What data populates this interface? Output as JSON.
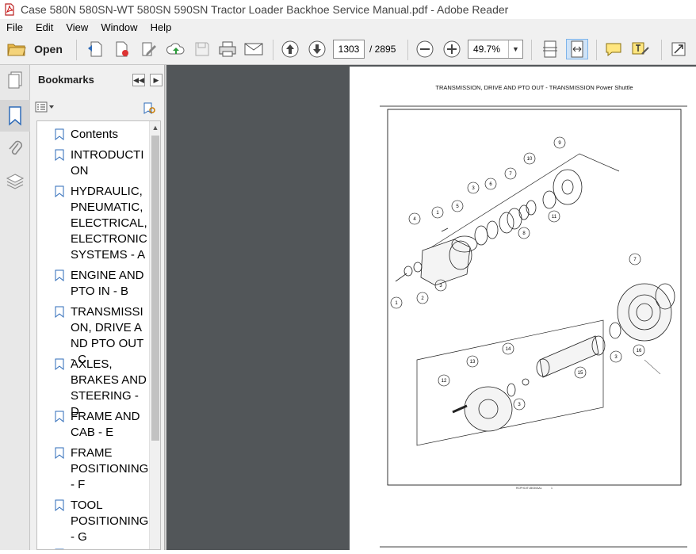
{
  "window": {
    "title": "Case 580N 580SN-WT 580SN 590SN Tractor Loader Backhoe Service Manual.pdf - Adobe Reader"
  },
  "menu": [
    "File",
    "Edit",
    "View",
    "Window",
    "Help"
  ],
  "toolbar": {
    "open_label": "Open",
    "page_number": "1303",
    "page_total": "/ 2895",
    "zoom": "49.7%"
  },
  "bookmarks": {
    "header": "Bookmarks",
    "items": [
      {
        "label": "Contents"
      },
      {
        "label": "INTRODUCTION"
      },
      {
        "label": "HYDRAULIC, PNEUMATIC, ELECTRICAL,ELECTRONIC SYSTEMS - A"
      },
      {
        "label": "ENGINE AND PTO IN - B"
      },
      {
        "label": "TRANSMISSION, DRIVE AND PTO OUT - C"
      },
      {
        "label": "AXLES, BRAKES AND STEERING - D"
      },
      {
        "label": "FRAME AND CAB - E"
      },
      {
        "label": "FRAME POSITIONING - F"
      },
      {
        "label": "TOOL POSITIONING - G"
      }
    ]
  },
  "document": {
    "page_header": "TRANSMISSION, DRIVE AND PTO OUT - TRANSMISSION Power Shuttle",
    "footer_code": "RCPH10TLB030AAL",
    "footer_num": "1",
    "callouts": [
      "1",
      "2",
      "3",
      "4",
      "5",
      "6",
      "7",
      "8",
      "9",
      "10",
      "11",
      "12",
      "13",
      "14",
      "15",
      "16"
    ]
  },
  "colors": {
    "doc_background": "#525659",
    "panel": "#f0f0f0",
    "accent_blue": "#2e6bb8"
  }
}
